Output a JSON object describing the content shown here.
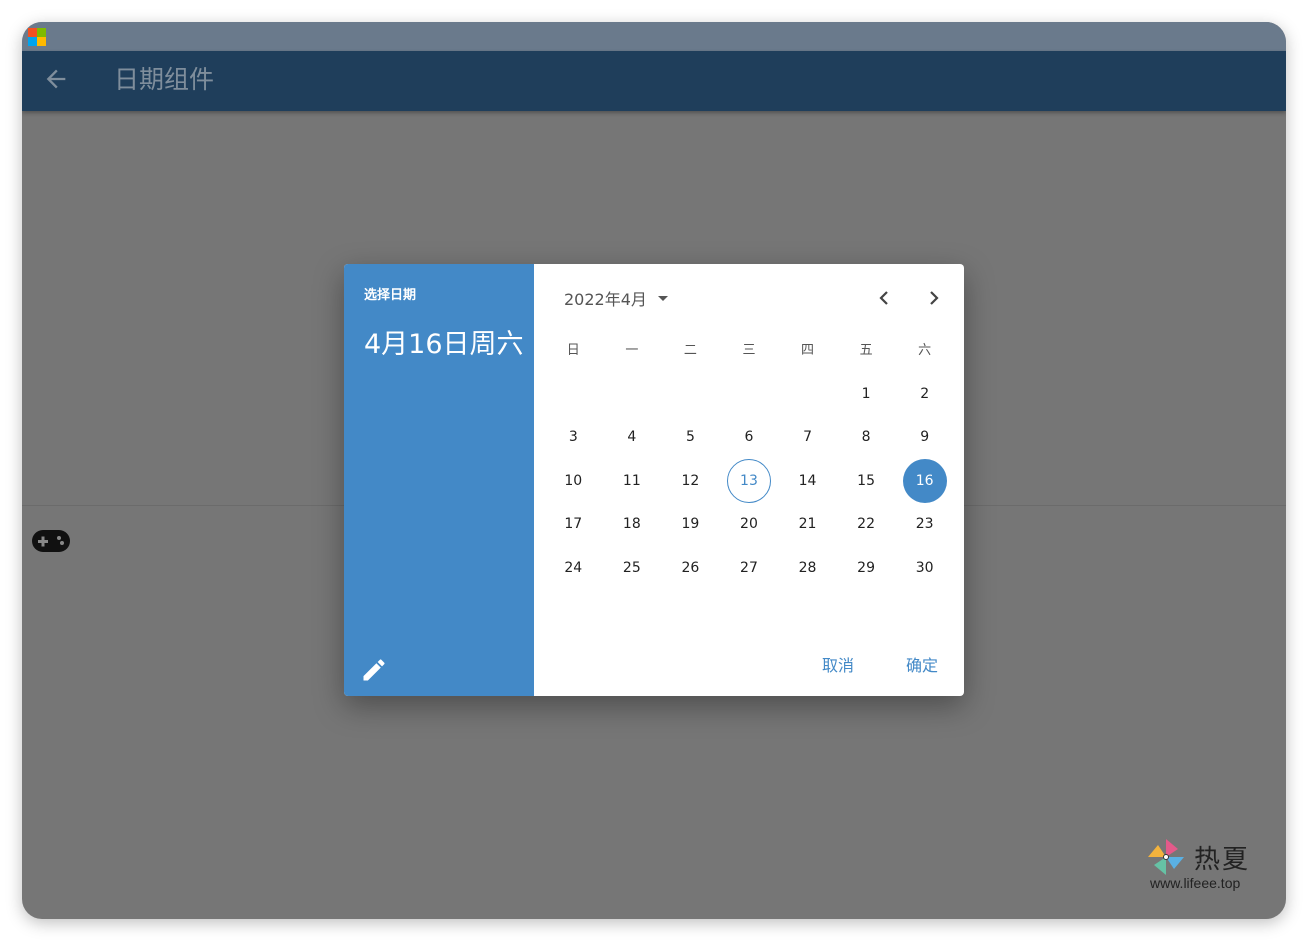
{
  "colors": {
    "accent": "#4389c7",
    "appbar": "#1f3e5b",
    "scrim": "#767676"
  },
  "app": {
    "title": "日期组件",
    "back_icon": "arrow-back-icon"
  },
  "dialog": {
    "help_text": "选择日期",
    "headline": "4月16日周六",
    "month_label": "2022年4月",
    "weekdays": [
      "日",
      "一",
      "二",
      "三",
      "四",
      "五",
      "六"
    ],
    "days": [
      "",
      "",
      "",
      "",
      "",
      "1",
      "2",
      "3",
      "4",
      "5",
      "6",
      "7",
      "8",
      "9",
      "10",
      "11",
      "12",
      "13",
      "14",
      "15",
      "16",
      "17",
      "18",
      "19",
      "20",
      "21",
      "22",
      "23",
      "24",
      "25",
      "26",
      "27",
      "28",
      "29",
      "30"
    ],
    "today": "13",
    "selected": "16",
    "cancel_label": "取消",
    "ok_label": "确定"
  },
  "watermark": {
    "name": "热夏",
    "url": "www.lifeee.top"
  }
}
